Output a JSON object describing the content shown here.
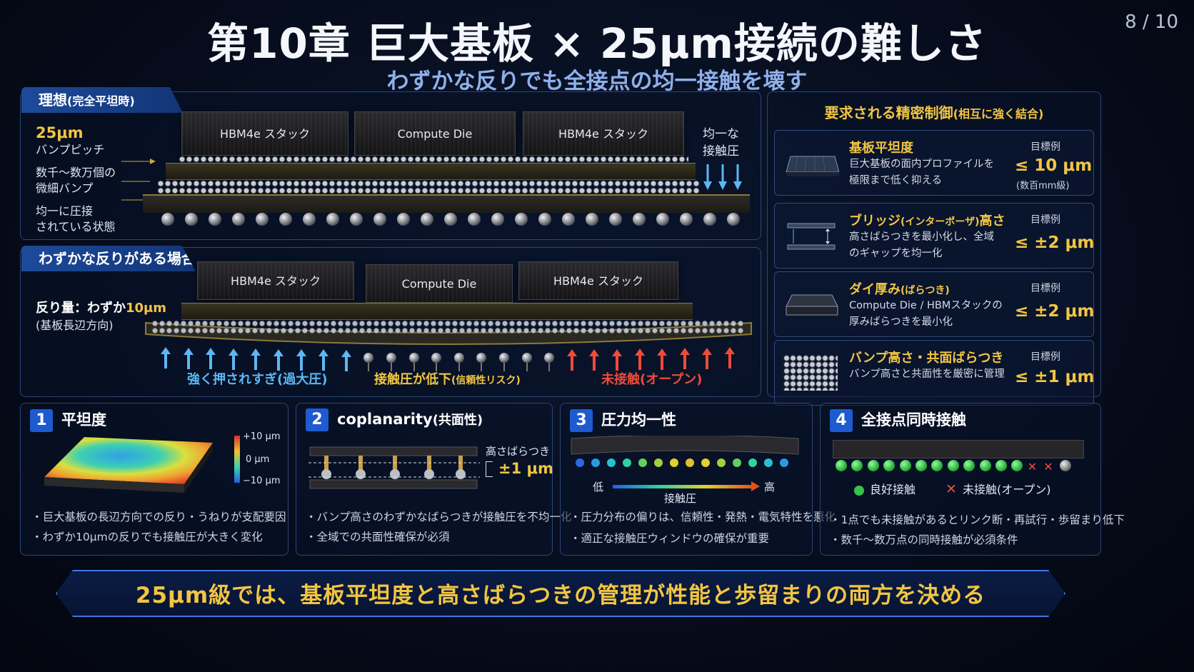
{
  "header": {
    "title": "第10章 巨大基板 × 25μm接続の難しさ",
    "subtitle": "わずかな反りでも全接点の均一接触を壊す",
    "page": "8 / 10"
  },
  "ideal": {
    "tab": "理想",
    "tab_note": "(完全平坦時)",
    "pitch_value": "25μm",
    "pitch_label": "バンプピッチ",
    "bumps_line1": "数千〜数万個の",
    "bumps_line2": "微細バンプ",
    "pressed_line1": "均一に圧接",
    "pressed_line2": "されている状態",
    "chip_left": "HBM4e スタック",
    "chip_center": "Compute Die",
    "chip_right": "HBM4e スタック",
    "pressure_line1": "均一な",
    "pressure_line2": "接触圧"
  },
  "warp": {
    "tab": "わずかな反りがある場合",
    "amount_prefix": "反り量：わずか",
    "amount_value": "10μm",
    "direction": "(基板長辺方向)",
    "chip_left": "HBM4e スタック",
    "chip_center": "Compute Die",
    "chip_right": "HBM4e スタック",
    "over": "強く押されすぎ(過大圧)",
    "low": "接触圧が低下",
    "low_note": "(信頼性リスク)",
    "open": "未接触(オープン)"
  },
  "requirements": {
    "title": "要求される精密制御",
    "title_note": "(相互に強く結合)",
    "target_label": "目標例",
    "items": [
      {
        "name": "基板平坦度",
        "name_note": "",
        "desc": "巨大基板の面内プロファイルを極限まで低く抑える",
        "value": "≤ 10 μm",
        "sub": "(数百mm級)"
      },
      {
        "name": "ブリッジ",
        "name_note": "(インターポーザ)",
        "name_tail": "高さ",
        "desc": "高さばらつきを最小化し、全域のギャップを均一化",
        "value": "≤ ±2 μm",
        "sub": ""
      },
      {
        "name": "ダイ厚み",
        "name_note": "(ばらつき)",
        "desc": "Compute Die / HBMスタックの厚みばらつきを最小化",
        "value": "≤ ±2 μm",
        "sub": ""
      },
      {
        "name": "バンプ高さ・共面ばらつき",
        "name_note": "",
        "desc": "バンプ高さと共面性を厳密に管理",
        "value": "≤ ±1 μm",
        "sub": ""
      }
    ]
  },
  "cards": [
    {
      "num": "1",
      "title": "平坦度",
      "scale_top": "+10 μm",
      "scale_mid": "0 μm",
      "scale_bot": "−10 μm",
      "b1": "巨大基板の長辺方向での反り・うねりが支配要因",
      "b2": "わずか10μmの反りでも接触圧が大きく変化"
    },
    {
      "num": "2",
      "title": "coplanarity",
      "title_note": "(共面性)",
      "label": "高さばらつき",
      "value": "±1 μm",
      "b1": "バンプ高さのわずかなばらつきが接触圧を不均一化",
      "b2": "全域での共面性確保が必須"
    },
    {
      "num": "3",
      "title": "圧力均一性",
      "low": "低",
      "high": "高",
      "axis": "接触圧",
      "b1": "圧力分布の偏りは、信頼性・発熱・電気特性を悪化",
      "b2": "適正な接触圧ウィンドウの確保が重要"
    },
    {
      "num": "4",
      "title": "全接点同時接触",
      "good": "良好接触",
      "open": "未接触(オープン)",
      "b1": "1点でも未接触があるとリンク断・再試行・歩留まり低下",
      "b2": "数千〜数万点の同時接触が必須条件"
    }
  ],
  "footer": {
    "message": "25μm級では、基板平坦度と高さばらつきの管理が性能と歩留まりの両方を決める"
  },
  "colors": {
    "accent": "#f2c542",
    "blue": "#1e5bd1",
    "over": "#5bb8f5",
    "open": "#f04a3a"
  }
}
